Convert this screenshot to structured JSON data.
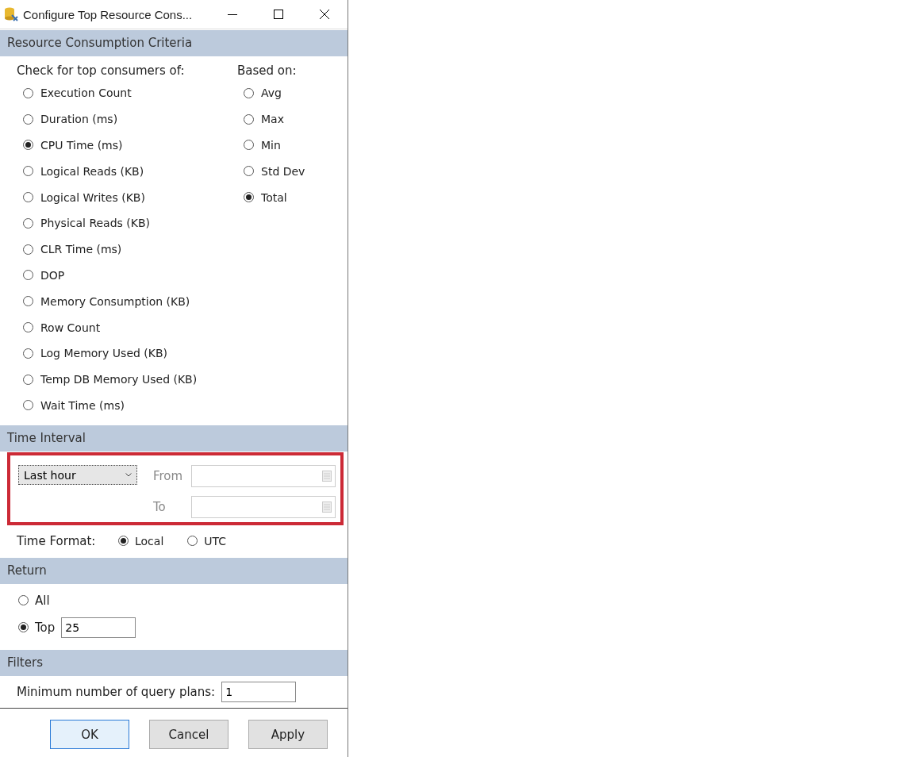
{
  "window": {
    "title": "Configure Top Resource Cons..."
  },
  "criteria": {
    "header": "Resource Consumption Criteria",
    "metrics_label": "Check for top consumers of:",
    "based_on_label": "Based on:",
    "metrics": [
      {
        "label": "Execution Count",
        "selected": false
      },
      {
        "label": "Duration (ms)",
        "selected": false
      },
      {
        "label": "CPU Time (ms)",
        "selected": true
      },
      {
        "label": "Logical Reads (KB)",
        "selected": false
      },
      {
        "label": "Logical Writes (KB)",
        "selected": false
      },
      {
        "label": "Physical Reads (KB)",
        "selected": false
      },
      {
        "label": "CLR Time (ms)",
        "selected": false
      },
      {
        "label": "DOP",
        "selected": false
      },
      {
        "label": "Memory Consumption (KB)",
        "selected": false
      },
      {
        "label": "Row Count",
        "selected": false
      },
      {
        "label": "Log Memory Used (KB)",
        "selected": false
      },
      {
        "label": "Temp DB Memory Used (KB)",
        "selected": false
      },
      {
        "label": "Wait Time (ms)",
        "selected": false
      }
    ],
    "based_on": [
      {
        "label": "Avg",
        "selected": false
      },
      {
        "label": "Max",
        "selected": false
      },
      {
        "label": "Min",
        "selected": false
      },
      {
        "label": "Std Dev",
        "selected": false
      },
      {
        "label": "Total",
        "selected": true
      }
    ]
  },
  "time_interval": {
    "header": "Time Interval",
    "highlighted": true,
    "range": "Last hour",
    "fields": [
      {
        "label": "From",
        "disabled": true
      },
      {
        "label": "To",
        "disabled": true
      }
    ],
    "format_label": "Time Format:",
    "formats": [
      {
        "label": "Local",
        "selected": true
      },
      {
        "label": "UTC",
        "selected": false
      }
    ]
  },
  "return": {
    "header": "Return",
    "options": [
      {
        "label": "All",
        "selected": false
      },
      {
        "label": "Top",
        "selected": true
      }
    ],
    "top_value": "25"
  },
  "filters": {
    "header": "Filters",
    "label": "Minimum number of query plans:",
    "value": "1"
  },
  "buttons": [
    {
      "label": "OK",
      "default": true
    },
    {
      "label": "Cancel",
      "default": false
    },
    {
      "label": "Apply",
      "default": false
    }
  ]
}
